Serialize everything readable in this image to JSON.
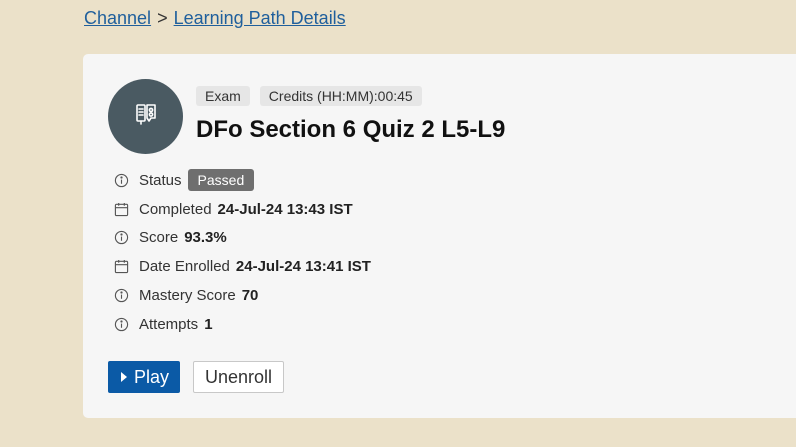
{
  "breadcrumb": {
    "channel": "Channel",
    "separator": ">",
    "current": "Learning Path Details"
  },
  "item": {
    "type_tag": "Exam",
    "credits_tag": "Credits (HH:MM):00:45",
    "title": "DFo Section 6 Quiz 2 L5-L9",
    "icon": "exam-document-icon"
  },
  "details": [
    {
      "label": "Status",
      "value": "Passed",
      "icon": "info-icon"
    },
    {
      "label": "Completed",
      "value": "24-Jul-24 13:43 IST",
      "icon": "calendar-icon"
    },
    {
      "label": "Score",
      "value": "93.3%",
      "icon": "info-icon"
    },
    {
      "label": "Date Enrolled",
      "value": "24-Jul-24 13:41 IST",
      "icon": "calendar-icon"
    },
    {
      "label": "Mastery Score",
      "value": "70",
      "icon": "info-icon"
    },
    {
      "label": "Attempts",
      "value": "1",
      "icon": "info-icon"
    }
  ],
  "actions": {
    "play_label": "Play",
    "unenroll_label": "Unenroll"
  },
  "colors": {
    "background": "#ebe1c9",
    "link": "#1f5f9c",
    "primary_button": "#0b5aa6",
    "status_badge": "#6f6f6f",
    "avatar": "#4a5a62"
  }
}
